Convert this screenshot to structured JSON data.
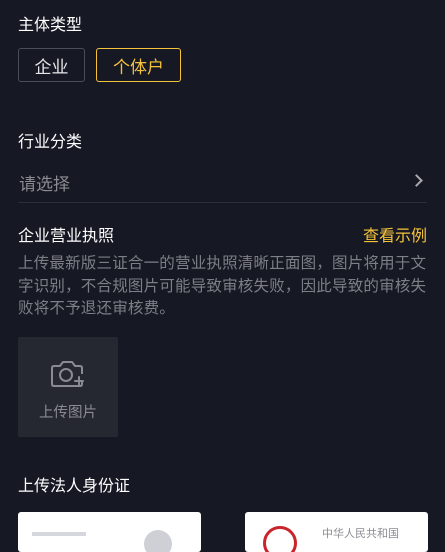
{
  "subject_type": {
    "title": "主体类型",
    "options": [
      "企业",
      "个体户"
    ],
    "selected": "个体户"
  },
  "industry": {
    "title": "行业分类",
    "placeholder": "请选择"
  },
  "license": {
    "title": "企业营业执照",
    "example_link": "查看示例",
    "description": "上传最新版三证合一的营业执照清晰正面图，图片将用于文字识别，不合规图片可能导致审核失败，因此导致的审核失败将不予退还审核费。",
    "upload_label": "上传图片"
  },
  "id_card": {
    "title": "上传法人身份证",
    "back_card_text": "中华人民共和国"
  },
  "colors": {
    "background": "#161823",
    "accent": "#f5c33b",
    "muted_text": "#7d7f87"
  }
}
